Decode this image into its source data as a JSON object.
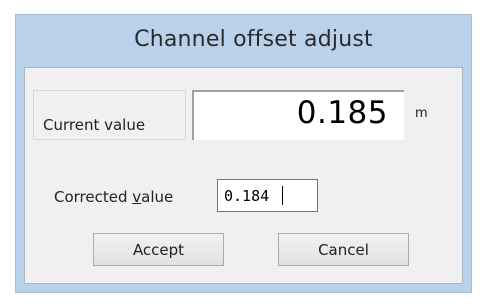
{
  "window": {
    "title": "Channel offset adjust"
  },
  "current": {
    "label": "Current value",
    "value": "0.185",
    "unit": "m"
  },
  "corrected": {
    "label_prefix": "Corrected ",
    "label_accel": "v",
    "label_suffix": "alue",
    "value": "0.184"
  },
  "buttons": {
    "accept": "Accept",
    "cancel": "Cancel"
  },
  "colors": {
    "frame": "#b9d1ea",
    "client": "#f0f0f0",
    "focus_border": "#3c7fd1"
  }
}
